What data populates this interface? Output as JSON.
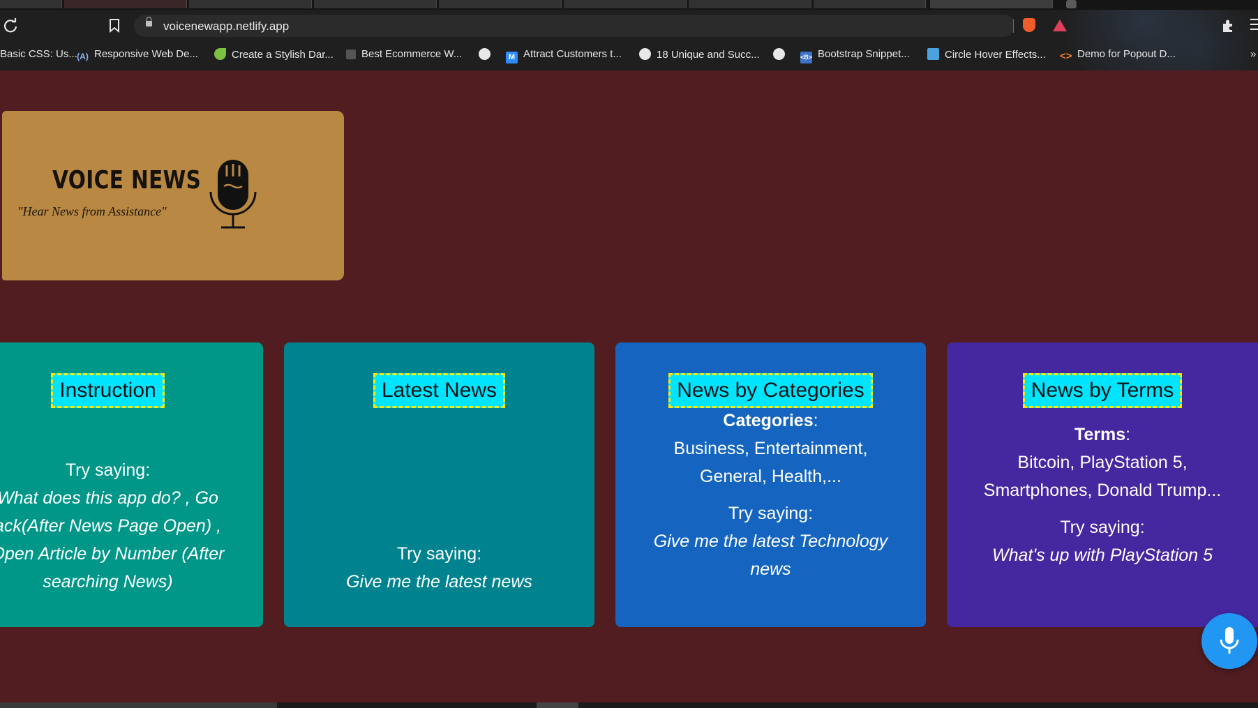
{
  "browser": {
    "url": "voicenewapp.netlify.app",
    "bookmarks": [
      {
        "label": "Basic CSS: Us...",
        "icon": "none"
      },
      {
        "label": "Responsive Web De...",
        "icon": "a11y-icon"
      },
      {
        "label": "Create a Stylish Dar...",
        "icon": "leaf-icon"
      },
      {
        "label": "Best Ecommerce W...",
        "icon": "chart-icon"
      },
      {
        "label": "",
        "icon": "globe-icon"
      },
      {
        "label": "Attract Customers t...",
        "icon": "m-icon"
      },
      {
        "label": "18 Unique and Succ...",
        "icon": "globe-icon"
      },
      {
        "label": "",
        "icon": "globe-icon"
      },
      {
        "label": "Bootstrap Snippet...",
        "icon": "bootstrap-icon"
      },
      {
        "label": "Circle Hover Effects...",
        "icon": "drop-icon"
      },
      {
        "label": "Demo for Popout D...",
        "icon": "code-icon"
      }
    ],
    "overflow": "»"
  },
  "logo": {
    "title": "VOICE NEWS",
    "tagline": "\"Hear News  from Assistance\""
  },
  "cards": [
    {
      "title": "Instruction",
      "try_label": "Try saying:",
      "examples": [
        "What does this app do? , Go",
        "ack(After News Page Open) ,",
        "Open Article by Number (After",
        "searching News)"
      ],
      "color": "#009688"
    },
    {
      "title": "Latest News",
      "try_label": "Try saying:",
      "examples": [
        "Give me the latest news"
      ],
      "color": "#00838f"
    },
    {
      "title": "News by Categories",
      "list_label": "Categories",
      "list_items": [
        "Business, Entertainment,",
        "General, Health,..."
      ],
      "try_label": "Try saying:",
      "examples": [
        "Give me the latest Technology",
        "news"
      ],
      "color": "#1565c0"
    },
    {
      "title": "News by Terms",
      "list_label": "Terms",
      "list_items": [
        "Bitcoin, PlayStation 5,",
        "Smartphones, Donald Trump..."
      ],
      "try_label": "Try saying:",
      "examples": [
        "What's up with PlayStation 5"
      ],
      "color": "#4527a0"
    }
  ],
  "colors": {
    "page_bg": "#511d21",
    "title_bg": "#00e5ff",
    "title_border": "#ffeb00",
    "fab": "#2196f3"
  }
}
